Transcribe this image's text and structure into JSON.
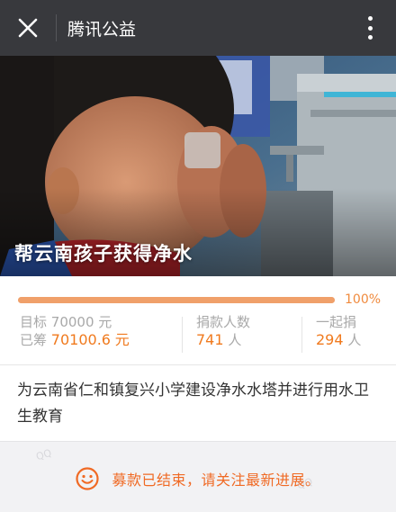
{
  "header": {
    "title": "腾讯公益"
  },
  "hero": {
    "headline": "帮云南孩子获得净水"
  },
  "progress": {
    "percent_label": "100%",
    "fraction": 1.0
  },
  "stats": {
    "target_label": "目标",
    "target_value": "70000 元",
    "raised_label": "已筹",
    "raised_value": "70100.6",
    "raised_unit": "元",
    "donors_label": "捐款人数",
    "donors_value": "741",
    "donors_unit": "人",
    "together_label": "一起捐",
    "together_value": "294",
    "together_unit": "人"
  },
  "description": "为云南省仁和镇复兴小学建设净水水塔并进行用水卫生教育",
  "banner": {
    "message": "募款已结束，请关注最新进展。"
  },
  "colors": {
    "topbar": "#38393d",
    "accent": "#f07a1e",
    "progress_fill": "#f0a06a",
    "banner_text": "#f06a24"
  },
  "icons": {
    "close": "close-icon",
    "more": "more-vertical-icon",
    "smile": "smile-icon"
  }
}
